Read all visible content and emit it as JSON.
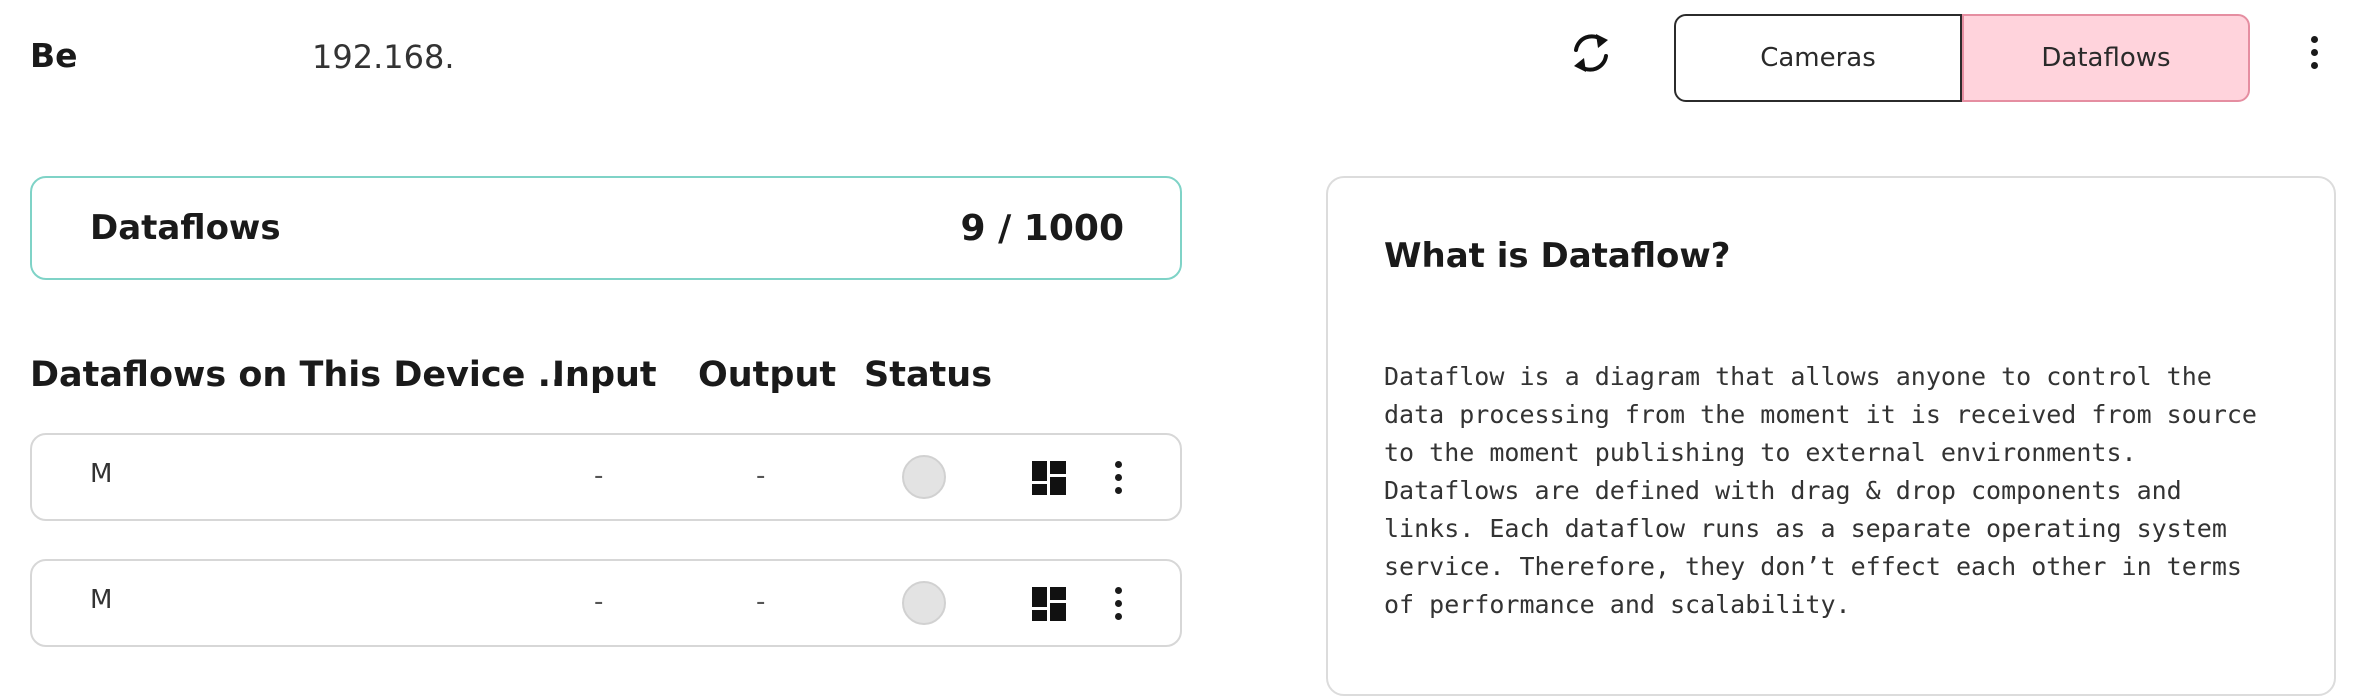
{
  "header": {
    "brand": "Be",
    "ip": "192.168.",
    "refresh_icon": "refresh-icon",
    "tabs": [
      {
        "label": "Cameras",
        "active": false
      },
      {
        "label": "Dataflows",
        "active": true
      }
    ],
    "menu_icon": "kebab-menu-icon"
  },
  "summary": {
    "label": "Dataflows",
    "count": "9 / 1000"
  },
  "table": {
    "headers": [
      "Dataflows on This Device ...",
      "Input",
      "Output",
      "Status"
    ],
    "rows": [
      {
        "name": "M",
        "input": "-",
        "output": "-",
        "status": "inactive"
      },
      {
        "name": "M",
        "input": "-",
        "output": "-",
        "status": "inactive"
      }
    ]
  },
  "info": {
    "title": "What is Dataflow?",
    "body": "Dataflow is a diagram that allows anyone to control the data processing from the moment it is received from source to the moment publishing to external environments. Dataflows are defined with drag & drop components and links. Each dataflow runs as a separate operating system service. Therefore, they don’t effect each other in terms of performance and scalability."
  },
  "colors": {
    "accent_teal": "#7fd3c7",
    "active_tab_bg": "#ffd3dc",
    "active_tab_border": "#e58ea1",
    "status_inactive": "#e3e3e3"
  }
}
